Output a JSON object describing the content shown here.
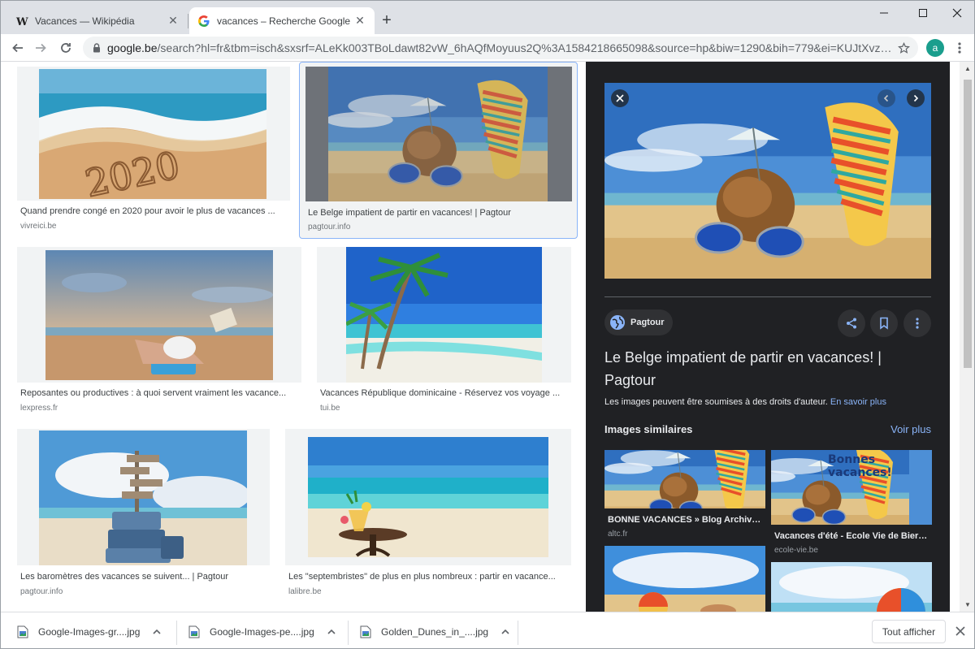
{
  "browser": {
    "tabs": [
      {
        "title": "Vacances — Wikipédia",
        "favicon": "wikipedia-icon",
        "active": false
      },
      {
        "title": "vacances – Recherche Google",
        "favicon": "google-icon",
        "active": true
      }
    ],
    "new_tab_label": "+",
    "url_host": "google.be",
    "url_path": "/search?hl=fr&tbm=isch&sxsrf=ALeKk003TBoLdawt82vW_6hAQfMoyuus2Q%3A1584218665098&source=hp&biw=1290&bih=779&ei=KUJtXvz2AseBkwXv...",
    "avatar_letter": "a"
  },
  "results": [
    {
      "caption": "Quand prendre congé en 2020 pour avoir le plus de vacances ...",
      "source": "vivreici.be",
      "image": "beach-2020-sand"
    },
    {
      "caption": "Le Belge impatient de partir en vacances! | Pagtour",
      "source": "pagtour.info",
      "image": "coconut-flipflops",
      "selected": true
    },
    {
      "caption": "Reposantes ou productives : à quoi servent vraiment les vacance...",
      "source": "lexpress.fr",
      "image": "woman-reading-beach"
    },
    {
      "caption": "Vacances République dominicaine - Réservez vos voyage ...",
      "source": "tui.be",
      "image": "palm-trees-beach"
    },
    {
      "caption": "Les baromètres des vacances se suivent... | Pagtour",
      "source": "pagtour.info",
      "image": "suitcases-signpost"
    },
    {
      "caption": "Les \"septembristes\" de plus en plus nombreux : partir en vacance...",
      "source": "lalibre.be",
      "image": "cocktail-beach-table"
    }
  ],
  "panel": {
    "source_chip": "Pagtour",
    "title": "Le Belge impatient de partir en vacances! | Pagtour",
    "rights_text": "Les images peuvent être soumises à des droits d'auteur.",
    "rights_link": "En savoir plus",
    "similar_heading": "Images similaires",
    "see_more": "Voir plus",
    "similar": [
      {
        "title": "BONNE VACANCES » Blog Archive »...",
        "source": "altc.fr"
      },
      {
        "title": "Vacances d'été - Ecole Vie de Bierges",
        "source": "ecole-vie.be",
        "overlay_text": "Bonnes vacances!"
      },
      {
        "title": "",
        "source": ""
      },
      {
        "title": "",
        "source": ""
      }
    ]
  },
  "downloads": {
    "items": [
      {
        "name": "Google-Images-gr....jpg"
      },
      {
        "name": "Google-Images-pe....jpg"
      },
      {
        "name": "Golden_Dunes_in_....jpg"
      }
    ],
    "show_all": "Tout afficher"
  }
}
